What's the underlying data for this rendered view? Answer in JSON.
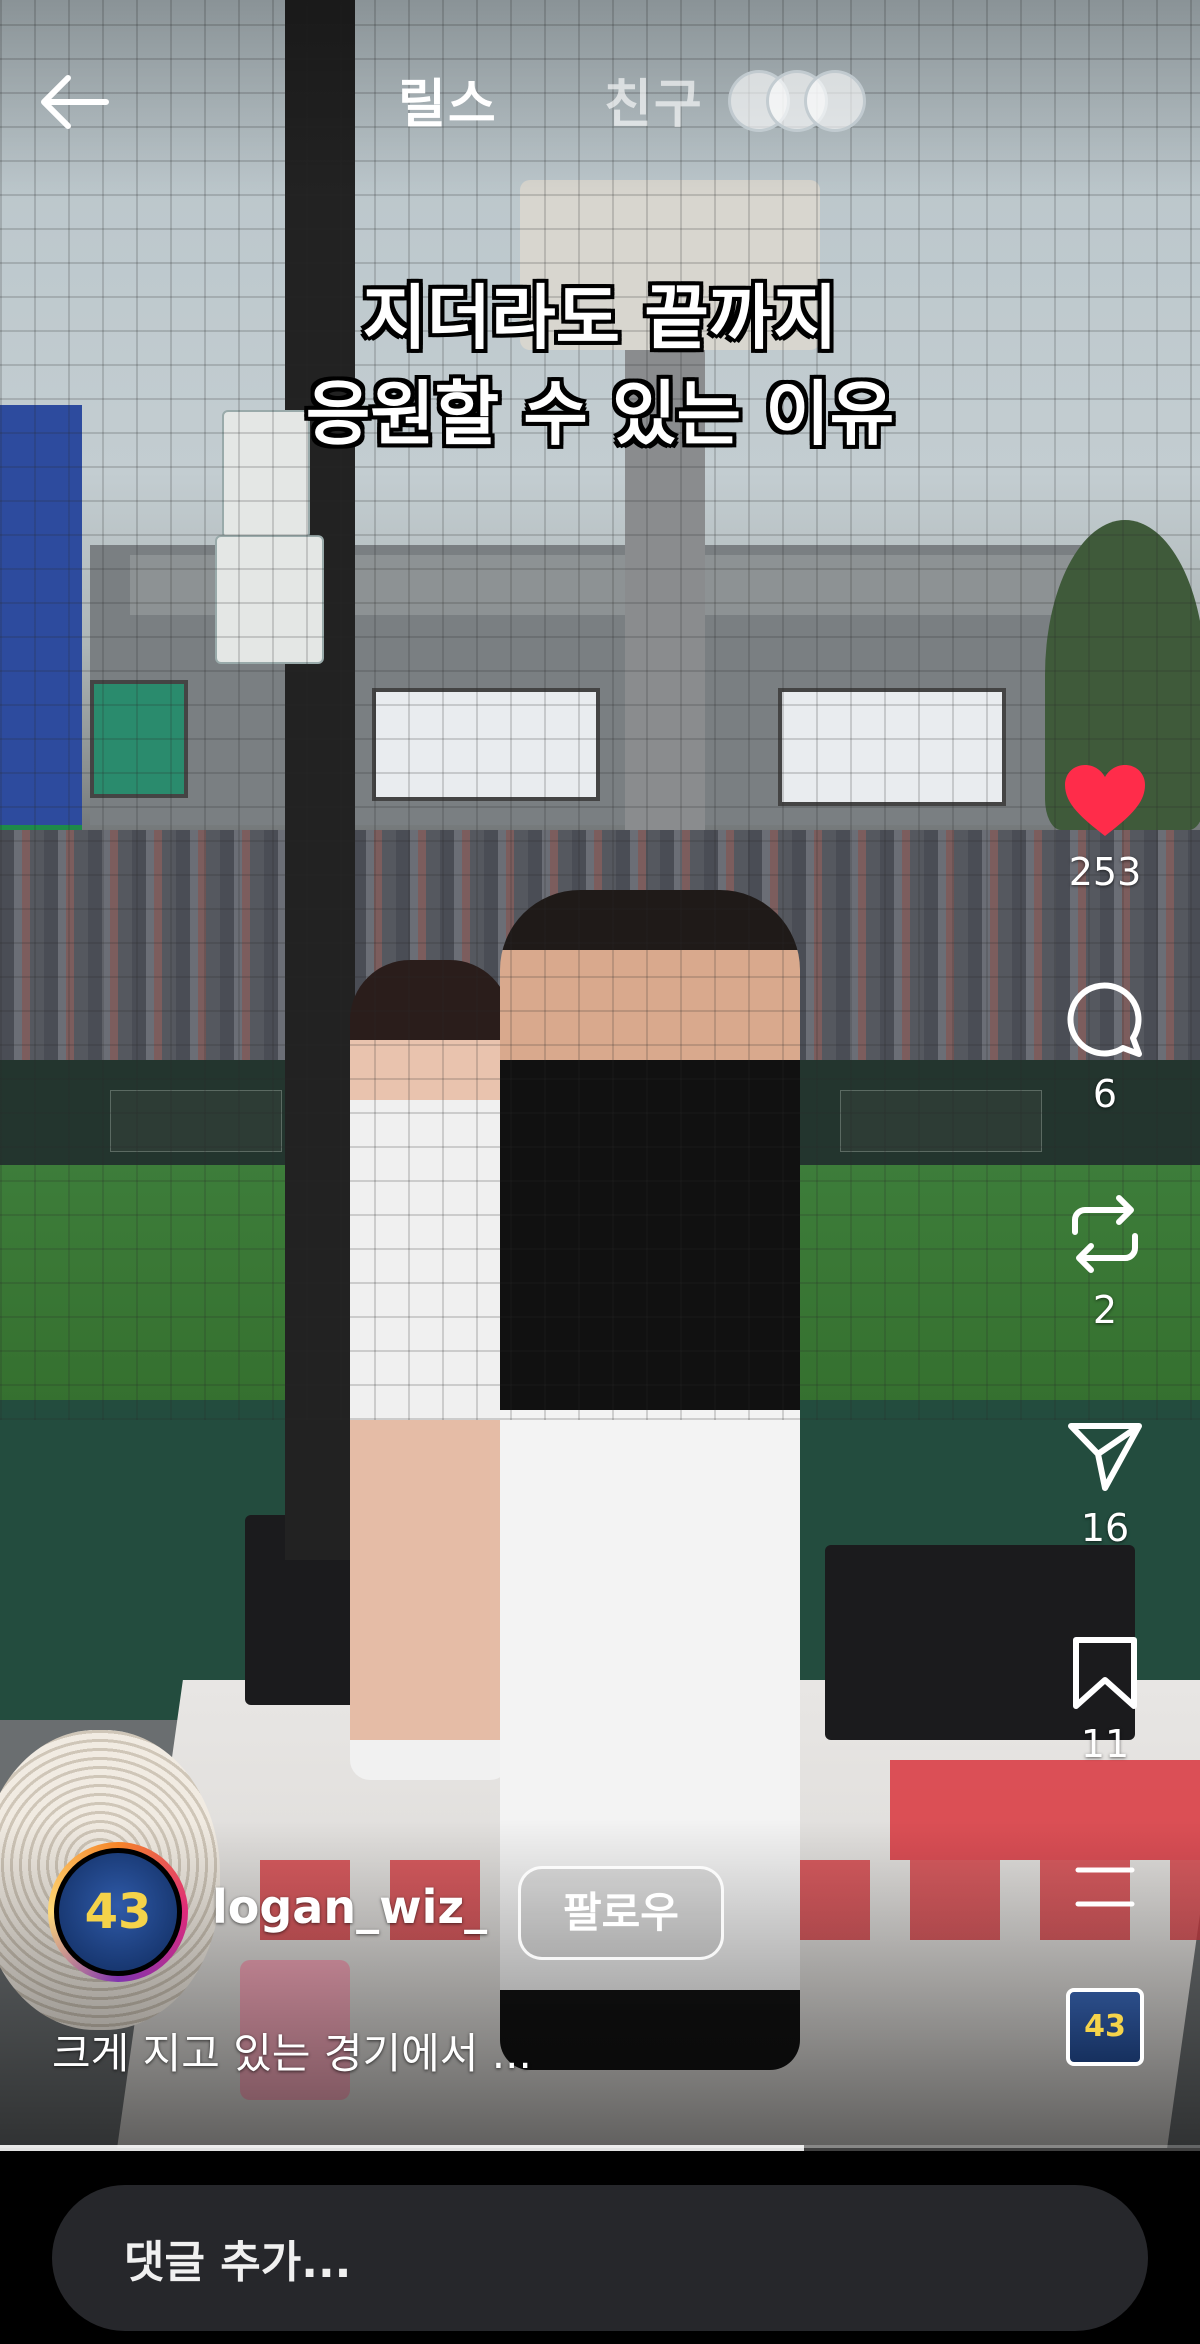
{
  "nav": {
    "tab_reels": "릴스",
    "tab_friends": "친구"
  },
  "overlay_caption": {
    "line1": "지더라도 끝까지",
    "line2": "응원할 수 있는 이유"
  },
  "actions": {
    "like_count": "253",
    "comment_count": "6",
    "repost_count": "2",
    "share_count": "16",
    "save_count": "11"
  },
  "author": {
    "username": "logan_wiz_",
    "follow_label": "팔로우"
  },
  "post": {
    "description": "크게 지고 있는 경기에서 ..."
  },
  "comment_bar": {
    "placeholder": "댓글 추가..."
  },
  "playback": {
    "progress_fraction": 0.67
  },
  "colors": {
    "like_active": "#ff2c4a",
    "comment_field_bg": "#26272b"
  },
  "icons": [
    "back-arrow-icon",
    "heart-icon",
    "comment-icon",
    "repost-icon",
    "share-icon",
    "bookmark-icon",
    "more-icon",
    "music-icon"
  ]
}
